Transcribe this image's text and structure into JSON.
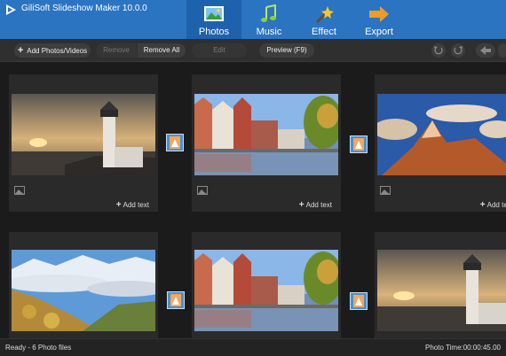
{
  "app": {
    "title": "GiliSoft Slideshow Maker 10.0.0"
  },
  "tabs": [
    {
      "label": "Photos",
      "icon": "photos-icon",
      "active": true
    },
    {
      "label": "Music",
      "icon": "music-icon"
    },
    {
      "label": "Effect",
      "icon": "effect-icon"
    },
    {
      "label": "Export",
      "icon": "export-icon"
    }
  ],
  "toolbar": {
    "add_label": "Add Photos/Videos",
    "remove_label": "Remove",
    "remove_all_label": "Remove All",
    "edit_label": "Edit",
    "preview_label": "Preview (F9)"
  },
  "cards": [
    {
      "add_text_label": "Add text"
    },
    {
      "add_text_label": "Add text"
    },
    {
      "add_text_label": "Add text"
    }
  ],
  "status": {
    "left": "Ready - 6 Photo files",
    "right": "Photo Time:00:00:45.00"
  },
  "colors": {
    "accent": "#2b74c2",
    "active_tab": "#1e62ad",
    "background": "#1b1b1b",
    "card": "#2a2a2a"
  }
}
